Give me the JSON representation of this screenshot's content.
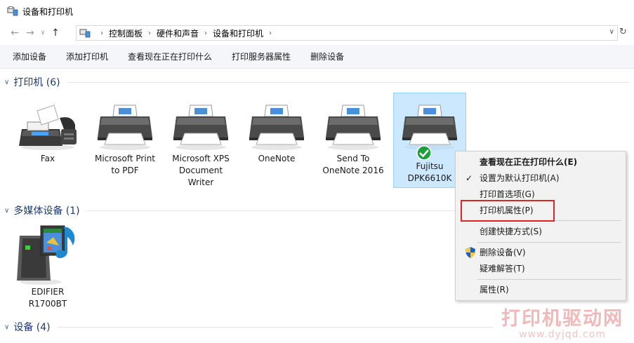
{
  "window": {
    "title": "设备和打印机"
  },
  "nav": {
    "breadcrumbs": [
      "控制面板",
      "硬件和声音",
      "设备和打印机"
    ]
  },
  "toolbar": {
    "buttons": [
      "添加设备",
      "添加打印机",
      "查看现在正在打印什么",
      "打印服务器属性",
      "删除设备"
    ]
  },
  "groups": {
    "printers": {
      "title": "打印机 (6)"
    },
    "multimedia": {
      "title": "多媒体设备 (1)"
    },
    "devices": {
      "title": "设备 (4)"
    }
  },
  "printers": [
    {
      "line1": "Fax",
      "line2": "",
      "line3": ""
    },
    {
      "line1": "Microsoft Print",
      "line2": "to PDF",
      "line3": ""
    },
    {
      "line1": "Microsoft XPS",
      "line2": "Document",
      "line3": "Writer"
    },
    {
      "line1": "OneNote",
      "line2": "",
      "line3": ""
    },
    {
      "line1": "Send To",
      "line2": "OneNote 2016",
      "line3": ""
    },
    {
      "line1": "Fujitsu",
      "line2": "DPK6610K",
      "line3": ""
    }
  ],
  "multimedia": [
    {
      "line1": "EDIFIER",
      "line2": "R1700BT"
    }
  ],
  "context_menu": {
    "items": [
      {
        "label": "查看现在正在打印什么(E)"
      },
      {
        "label": "设置为默认打印机(A)"
      },
      {
        "label": "打印首选项(G)"
      },
      {
        "label": "打印机属性(P)"
      },
      {
        "label": "创建快捷方式(S)"
      },
      {
        "label": "删除设备(V)"
      },
      {
        "label": "疑难解答(T)"
      },
      {
        "label": "属性(R)"
      }
    ]
  },
  "watermark": {
    "line1": "打印机驱动网",
    "line2": "www.dyjqd.com"
  },
  "colors": {
    "selection": "#cce8ff",
    "highlight_box": "#d9262b",
    "group_title": "#1e3a6e",
    "check_badge": "#1e9e3a"
  }
}
